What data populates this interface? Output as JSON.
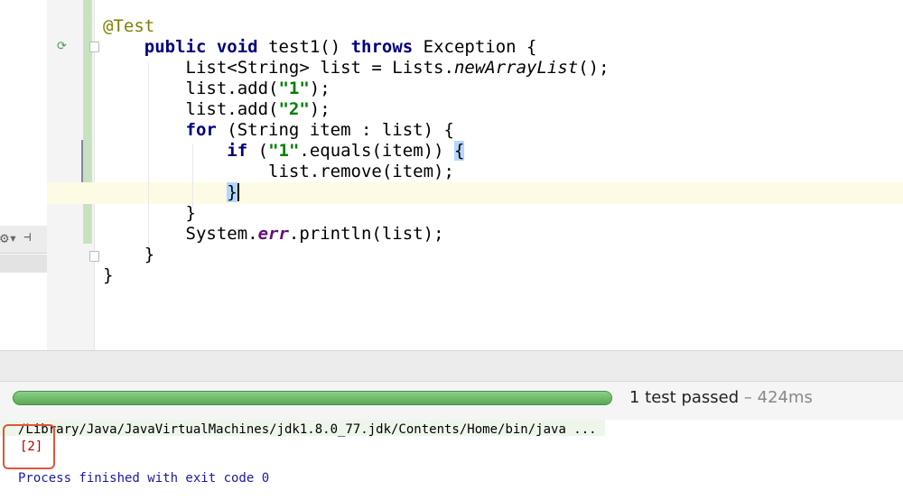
{
  "editor": {
    "annotation": "@Test",
    "method_signature": {
      "kw_public": "public",
      "kw_void": "void",
      "name": " test1() ",
      "kw_throws": "throws",
      "rest": " Exception {"
    },
    "line_list_decl": {
      "pre": "List<String> list = Lists.",
      "method": "newArrayList",
      "post": "();"
    },
    "line_add1": {
      "pre": "list.add(",
      "str": "\"1\"",
      "post": ");"
    },
    "line_add2": {
      "pre": "list.add(",
      "str": "\"2\"",
      "post": ");"
    },
    "line_for": {
      "kw": "for",
      "rest": " (String item : list) {"
    },
    "line_if": {
      "kw": "if",
      "pre": " (",
      "str": "\"1\"",
      "post": ".equals(item)) ",
      "brace": "{"
    },
    "line_remove": "list.remove(item);",
    "line_if_close": "}",
    "line_for_close": "}",
    "line_print": {
      "pre": "System.",
      "field": "err",
      "post": ".println(list);"
    },
    "line_method_close": "}",
    "line_class_close": "}",
    "icons": {
      "run": "run-test-icon",
      "fold": "fold-marker-icon",
      "settings": "gear-icon",
      "pin": "pin-icon"
    }
  },
  "run_panel": {
    "progress_fraction": 1.0,
    "status_main": "1 test passed",
    "status_dim": " – 424ms",
    "command": "/Library/Java/JavaVirtualMachines/jdk1.8.0_77.jdk/Contents/Home/bin/java ...",
    "output": "[2]",
    "process": "Process finished with exit code 0"
  },
  "colors": {
    "keyword": "#000080",
    "string": "#008000",
    "annotation": "#808000",
    "progress": "#5fae5a",
    "highlight_box": "#e0553a"
  }
}
